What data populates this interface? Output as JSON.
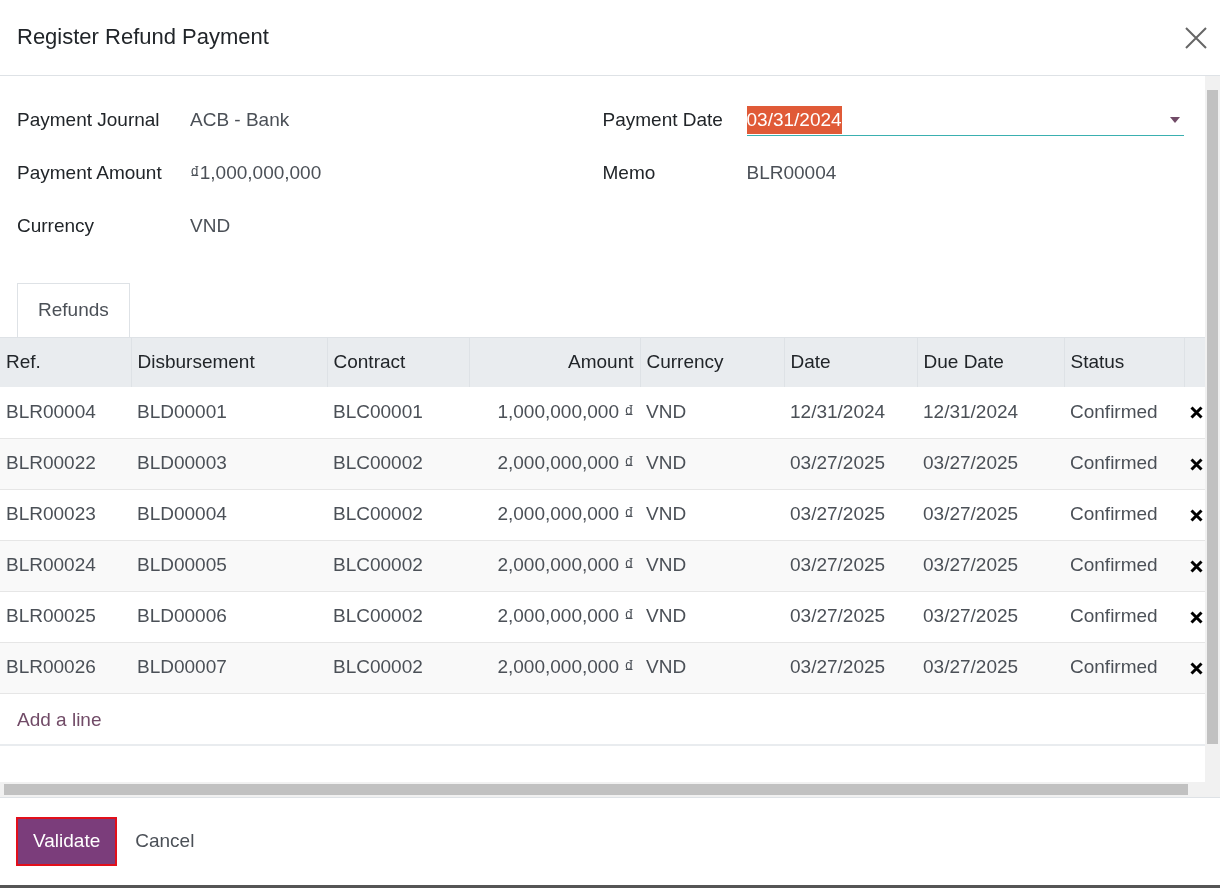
{
  "dialog": {
    "title": "Register Refund Payment"
  },
  "fields_left": [
    {
      "label": "Payment Journal",
      "value": "ACB - Bank"
    },
    {
      "label": "Payment Amount",
      "value": "₫1,000,000,000"
    },
    {
      "label": "Currency",
      "value": "VND"
    }
  ],
  "payment_date": {
    "label": "Payment Date",
    "value": "03/31/2024",
    "text_selected": true
  },
  "memo": {
    "label": "Memo",
    "value": "BLR00004"
  },
  "tabs": [
    {
      "label": "Refunds",
      "selected": true
    }
  ],
  "table": {
    "columns": [
      "Ref.",
      "Disbursement",
      "Contract",
      "Amount",
      "Currency",
      "Date",
      "Due Date",
      "Status"
    ],
    "rows": [
      [
        "BLR00004",
        "BLD00001",
        "BLC00001",
        "1,000,000,000 ₫",
        "VND",
        "12/31/2024",
        "12/31/2024",
        "Confirmed"
      ],
      [
        "BLR00022",
        "BLD00003",
        "BLC00002",
        "2,000,000,000 ₫",
        "VND",
        "03/27/2025",
        "03/27/2025",
        "Confirmed"
      ],
      [
        "BLR00023",
        "BLD00004",
        "BLC00002",
        "2,000,000,000 ₫",
        "VND",
        "03/27/2025",
        "03/27/2025",
        "Confirmed"
      ],
      [
        "BLR00024",
        "BLD00005",
        "BLC00002",
        "2,000,000,000 ₫",
        "VND",
        "03/27/2025",
        "03/27/2025",
        "Confirmed"
      ],
      [
        "BLR00025",
        "BLD00006",
        "BLC00002",
        "2,000,000,000 ₫",
        "VND",
        "03/27/2025",
        "03/27/2025",
        "Confirmed"
      ],
      [
        "BLR00026",
        "BLD00007",
        "BLC00002",
        "2,000,000,000 ₫",
        "VND",
        "03/27/2025",
        "03/27/2025",
        "Confirmed"
      ]
    ],
    "add_line": "Add a line"
  },
  "buttons": [
    {
      "label": "Validate",
      "kind": "primary"
    },
    {
      "label": "Cancel",
      "kind": "secondary"
    }
  ]
}
